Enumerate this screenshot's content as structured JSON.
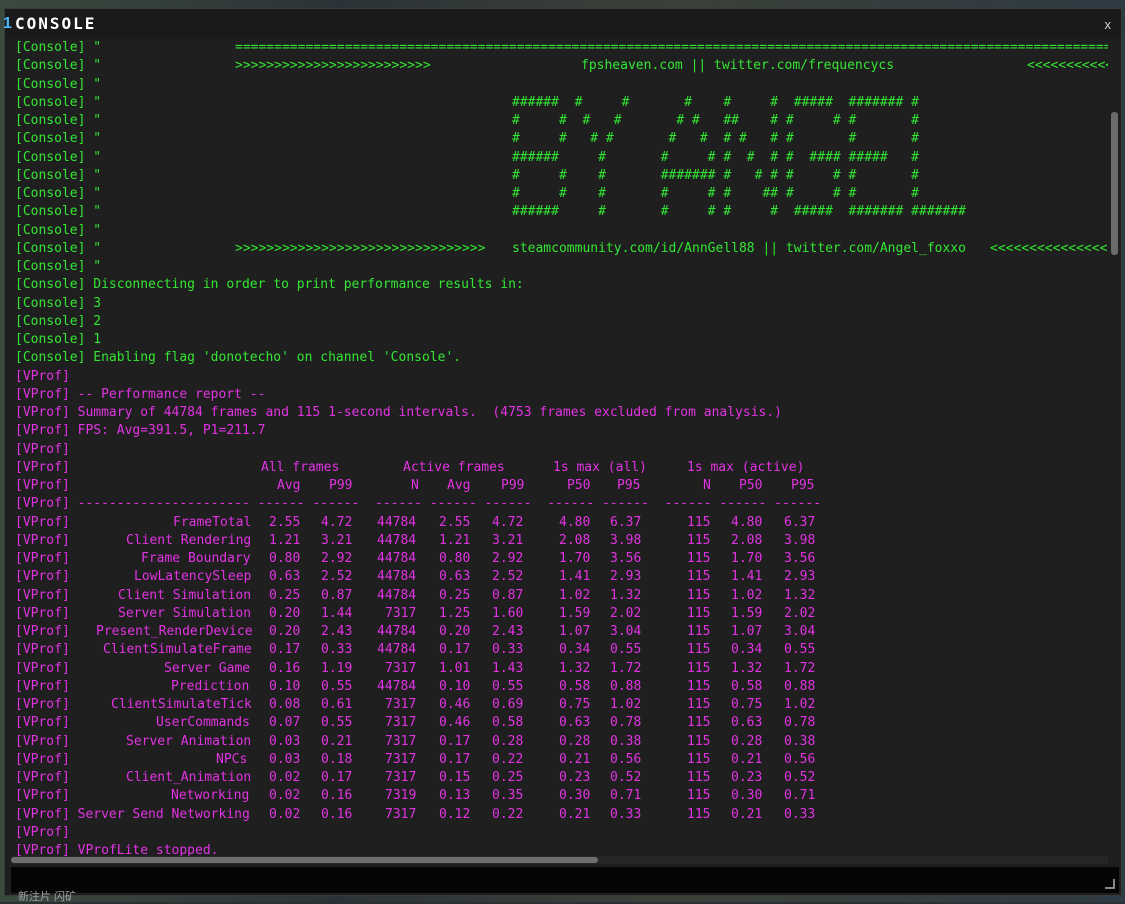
{
  "window": {
    "title_number": "1",
    "title": "CONSOLE",
    "close_label": "x"
  },
  "background_text": "新注片 闪矿",
  "lines": [
    {
      "t": "c",
      "seg": [
        [
          "[Console] \"",
          0
        ],
        [
          "==================================================================================================================================",
          220
        ]
      ]
    },
    {
      "t": "c",
      "seg": [
        [
          "[Console] \"",
          0
        ],
        [
          ">>>>>>>>>>>>>>>>>>>>>>>>>",
          220
        ],
        [
          "fpsheaven.com || twitter.com/frequencycs",
          566
        ],
        [
          "<<<<<<<<<<<<<<<",
          1012
        ]
      ]
    },
    {
      "t": "c",
      "seg": [
        [
          "[Console] \"",
          0
        ]
      ]
    },
    {
      "t": "c",
      "seg": [
        [
          "[Console] \"",
          0
        ],
        [
          "######  #     #       #    #     #  #####  ####### #",
          497
        ]
      ]
    },
    {
      "t": "c",
      "seg": [
        [
          "[Console] \"",
          0
        ],
        [
          "#     #  #   #       # #   ##    # #     # #       #",
          497
        ]
      ]
    },
    {
      "t": "c",
      "seg": [
        [
          "[Console] \"",
          0
        ],
        [
          "#     #   # #       #   #  # #   # #       #       #",
          497
        ]
      ]
    },
    {
      "t": "c",
      "seg": [
        [
          "[Console] \"",
          0
        ],
        [
          "######     #       #     # #  #  # #  #### #####   #",
          497
        ]
      ]
    },
    {
      "t": "c",
      "seg": [
        [
          "[Console] \"",
          0
        ],
        [
          "#     #    #       ####### #   # # #     # #       #",
          497
        ]
      ]
    },
    {
      "t": "c",
      "seg": [
        [
          "[Console] \"",
          0
        ],
        [
          "#     #    #       #     # #    ## #     # #       #",
          497
        ]
      ]
    },
    {
      "t": "c",
      "seg": [
        [
          "[Console] \"",
          0
        ],
        [
          "######     #       #     # #     #  #####  ####### #######",
          497
        ]
      ]
    },
    {
      "t": "c",
      "seg": [
        [
          "[Console] \"",
          0
        ]
      ]
    },
    {
      "t": "c",
      "seg": [
        [
          "[Console] \"",
          0
        ],
        [
          ">>>>>>>>>>>>>>>>>>>>>>>>>>>>>>>>",
          220
        ],
        [
          "steamcommunity.com/id/AnnGell88 || twitter.com/Angel_foxxo",
          497
        ],
        [
          "<<<<<<<<<<<<<<<",
          975
        ]
      ]
    },
    {
      "t": "c",
      "seg": [
        [
          "[Console] \"",
          0
        ]
      ]
    },
    {
      "t": "c",
      "seg": [
        [
          "[Console] Disconnecting in order to print performance results in:",
          0
        ]
      ]
    },
    {
      "t": "c",
      "seg": [
        [
          "[Console] 3",
          0
        ]
      ]
    },
    {
      "t": "c",
      "seg": [
        [
          "[Console] 2",
          0
        ]
      ]
    },
    {
      "t": "c",
      "seg": [
        [
          "[Console] 1",
          0
        ]
      ]
    },
    {
      "t": "c",
      "seg": [
        [
          "[Console] Enabling flag 'donotecho' on channel 'Console'.",
          0
        ]
      ]
    },
    {
      "t": "v",
      "seg": [
        [
          "[VProf]",
          0
        ]
      ]
    },
    {
      "t": "v",
      "seg": [
        [
          "[VProf] -- Performance report --",
          0
        ]
      ]
    },
    {
      "t": "v",
      "seg": [
        [
          "[VProf] Summary of 44784 frames and 115 1-second intervals.  (4753 frames excluded from analysis.)",
          0
        ]
      ]
    },
    {
      "t": "v",
      "seg": [
        [
          "[VProf] FPS: Avg=391.5, P1=211.7",
          0
        ]
      ]
    },
    {
      "t": "v",
      "seg": [
        [
          "[VProf]",
          0
        ]
      ]
    },
    {
      "t": "v",
      "seg": [
        [
          "[VProf]",
          0
        ],
        [
          "All frames",
          246
        ],
        [
          "Active frames",
          388
        ],
        [
          "1s max (all)",
          538
        ],
        [
          "1s max (active)",
          672
        ]
      ]
    },
    {
      "t": "v",
      "seg": [
        [
          "[VProf]",
          0
        ],
        [
          "Avg",
          262
        ],
        [
          "P99",
          314
        ],
        [
          "N",
          396
        ],
        [
          "Avg",
          432
        ],
        [
          "P99",
          486
        ],
        [
          "P50",
          552
        ],
        [
          "P95",
          602
        ],
        [
          "N",
          688
        ],
        [
          "P50",
          724
        ],
        [
          "P95",
          776
        ]
      ]
    },
    {
      "t": "v",
      "seg": [
        [
          "[VProf] ---------------------- ------ ------  ------ ------ ------  ------ ------  ------ ------ ------",
          0
        ]
      ]
    },
    {
      "t": "v",
      "seg": [
        [
          "[VProf]",
          0
        ],
        [
          "FrameTotal",
          158
        ],
        [
          "2.55",
          254
        ],
        [
          "4.72",
          306
        ],
        [
          "44784",
          362
        ],
        [
          "2.55",
          424
        ],
        [
          "4.72",
          477
        ],
        [
          "4.80",
          544
        ],
        [
          "6.37",
          595
        ],
        [
          "115",
          672
        ],
        [
          "4.80",
          716
        ],
        [
          "6.37",
          769
        ]
      ]
    },
    {
      "t": "v",
      "seg": [
        [
          "[VProf]",
          0
        ],
        [
          "Client Rendering",
          111
        ],
        [
          "1.21",
          254
        ],
        [
          "3.21",
          306
        ],
        [
          "44784",
          362
        ],
        [
          "1.21",
          424
        ],
        [
          "3.21",
          477
        ],
        [
          "2.08",
          544
        ],
        [
          "3.98",
          595
        ],
        [
          "115",
          672
        ],
        [
          "2.08",
          716
        ],
        [
          "3.98",
          769
        ]
      ]
    },
    {
      "t": "v",
      "seg": [
        [
          "[VProf]",
          0
        ],
        [
          "Frame Boundary",
          126
        ],
        [
          "0.80",
          254
        ],
        [
          "2.92",
          306
        ],
        [
          "44784",
          362
        ],
        [
          "0.80",
          424
        ],
        [
          "2.92",
          477
        ],
        [
          "1.70",
          544
        ],
        [
          "3.56",
          595
        ],
        [
          "115",
          672
        ],
        [
          "1.70",
          716
        ],
        [
          "3.56",
          769
        ]
      ]
    },
    {
      "t": "v",
      "seg": [
        [
          "[VProf]",
          0
        ],
        [
          "LowLatencySleep",
          119
        ],
        [
          "0.63",
          254
        ],
        [
          "2.52",
          306
        ],
        [
          "44784",
          362
        ],
        [
          "0.63",
          424
        ],
        [
          "2.52",
          477
        ],
        [
          "1.41",
          544
        ],
        [
          "2.93",
          595
        ],
        [
          "115",
          672
        ],
        [
          "1.41",
          716
        ],
        [
          "2.93",
          769
        ]
      ]
    },
    {
      "t": "v",
      "seg": [
        [
          "[VProf]",
          0
        ],
        [
          "Client Simulation",
          103
        ],
        [
          "0.25",
          254
        ],
        [
          "0.87",
          306
        ],
        [
          "44784",
          362
        ],
        [
          "0.25",
          424
        ],
        [
          "0.87",
          477
        ],
        [
          "1.02",
          544
        ],
        [
          "1.32",
          595
        ],
        [
          "115",
          672
        ],
        [
          "1.02",
          716
        ],
        [
          "1.32",
          769
        ]
      ]
    },
    {
      "t": "v",
      "seg": [
        [
          "[VProf]",
          0
        ],
        [
          "Server Simulation",
          103
        ],
        [
          "0.20",
          254
        ],
        [
          "1.44",
          306
        ],
        [
          "7317",
          370
        ],
        [
          "1.25",
          424
        ],
        [
          "1.60",
          477
        ],
        [
          "1.59",
          544
        ],
        [
          "2.02",
          595
        ],
        [
          "115",
          672
        ],
        [
          "1.59",
          716
        ],
        [
          "2.02",
          769
        ]
      ]
    },
    {
      "t": "v",
      "seg": [
        [
          "[VProf]",
          0
        ],
        [
          "Present_RenderDevice",
          81
        ],
        [
          "0.20",
          254
        ],
        [
          "2.43",
          306
        ],
        [
          "44784",
          362
        ],
        [
          "0.20",
          424
        ],
        [
          "2.43",
          477
        ],
        [
          "1.07",
          544
        ],
        [
          "3.04",
          595
        ],
        [
          "115",
          672
        ],
        [
          "1.07",
          716
        ],
        [
          "3.04",
          769
        ]
      ]
    },
    {
      "t": "v",
      "seg": [
        [
          "[VProf]",
          0
        ],
        [
          "ClientSimulateFrame",
          88
        ],
        [
          "0.17",
          254
        ],
        [
          "0.33",
          306
        ],
        [
          "44784",
          362
        ],
        [
          "0.17",
          424
        ],
        [
          "0.33",
          477
        ],
        [
          "0.34",
          544
        ],
        [
          "0.55",
          595
        ],
        [
          "115",
          672
        ],
        [
          "0.34",
          716
        ],
        [
          "0.55",
          769
        ]
      ]
    },
    {
      "t": "v",
      "seg": [
        [
          "[VProf]",
          0
        ],
        [
          "Server Game",
          149
        ],
        [
          "0.16",
          254
        ],
        [
          "1.19",
          306
        ],
        [
          "7317",
          370
        ],
        [
          "1.01",
          424
        ],
        [
          "1.43",
          477
        ],
        [
          "1.32",
          544
        ],
        [
          "1.72",
          595
        ],
        [
          "115",
          672
        ],
        [
          "1.32",
          716
        ],
        [
          "1.72",
          769
        ]
      ]
    },
    {
      "t": "v",
      "seg": [
        [
          "[VProf]",
          0
        ],
        [
          "Prediction",
          156
        ],
        [
          "0.10",
          254
        ],
        [
          "0.55",
          306
        ],
        [
          "44784",
          362
        ],
        [
          "0.10",
          424
        ],
        [
          "0.55",
          477
        ],
        [
          "0.58",
          544
        ],
        [
          "0.88",
          595
        ],
        [
          "115",
          672
        ],
        [
          "0.58",
          716
        ],
        [
          "0.88",
          769
        ]
      ]
    },
    {
      "t": "v",
      "seg": [
        [
          "[VProf]",
          0
        ],
        [
          "ClientSimulateTick",
          96
        ],
        [
          "0.08",
          254
        ],
        [
          "0.61",
          306
        ],
        [
          "7317",
          370
        ],
        [
          "0.46",
          424
        ],
        [
          "0.69",
          477
        ],
        [
          "0.75",
          544
        ],
        [
          "1.02",
          595
        ],
        [
          "115",
          672
        ],
        [
          "0.75",
          716
        ],
        [
          "1.02",
          769
        ]
      ]
    },
    {
      "t": "v",
      "seg": [
        [
          "[VProf]",
          0
        ],
        [
          "UserCommands",
          141
        ],
        [
          "0.07",
          254
        ],
        [
          "0.55",
          306
        ],
        [
          "7317",
          370
        ],
        [
          "0.46",
          424
        ],
        [
          "0.58",
          477
        ],
        [
          "0.63",
          544
        ],
        [
          "0.78",
          595
        ],
        [
          "115",
          672
        ],
        [
          "0.63",
          716
        ],
        [
          "0.78",
          769
        ]
      ]
    },
    {
      "t": "v",
      "seg": [
        [
          "[VProf]",
          0
        ],
        [
          "Server Animation",
          111
        ],
        [
          "0.03",
          254
        ],
        [
          "0.21",
          306
        ],
        [
          "7317",
          370
        ],
        [
          "0.17",
          424
        ],
        [
          "0.28",
          477
        ],
        [
          "0.28",
          544
        ],
        [
          "0.38",
          595
        ],
        [
          "115",
          672
        ],
        [
          "0.28",
          716
        ],
        [
          "0.38",
          769
        ]
      ]
    },
    {
      "t": "v",
      "seg": [
        [
          "[VProf]",
          0
        ],
        [
          "NPCs",
          201
        ],
        [
          "0.03",
          254
        ],
        [
          "0.18",
          306
        ],
        [
          "7317",
          370
        ],
        [
          "0.17",
          424
        ],
        [
          "0.22",
          477
        ],
        [
          "0.21",
          544
        ],
        [
          "0.56",
          595
        ],
        [
          "115",
          672
        ],
        [
          "0.21",
          716
        ],
        [
          "0.56",
          769
        ]
      ]
    },
    {
      "t": "v",
      "seg": [
        [
          "[VProf]",
          0
        ],
        [
          "Client_Animation",
          111
        ],
        [
          "0.02",
          254
        ],
        [
          "0.17",
          306
        ],
        [
          "7317",
          370
        ],
        [
          "0.15",
          424
        ],
        [
          "0.25",
          477
        ],
        [
          "0.23",
          544
        ],
        [
          "0.52",
          595
        ],
        [
          "115",
          672
        ],
        [
          "0.23",
          716
        ],
        [
          "0.52",
          769
        ]
      ]
    },
    {
      "t": "v",
      "seg": [
        [
          "[VProf]",
          0
        ],
        [
          "Networking",
          156
        ],
        [
          "0.02",
          254
        ],
        [
          "0.16",
          306
        ],
        [
          "7319",
          370
        ],
        [
          "0.13",
          424
        ],
        [
          "0.35",
          477
        ],
        [
          "0.30",
          544
        ],
        [
          "0.71",
          595
        ],
        [
          "115",
          672
        ],
        [
          "0.30",
          716
        ],
        [
          "0.71",
          769
        ]
      ]
    },
    {
      "t": "v",
      "seg": [
        [
          "[VProf] Server Send Networking",
          0
        ],
        [
          "0.02",
          254
        ],
        [
          "0.16",
          306
        ],
        [
          "7317",
          370
        ],
        [
          "0.12",
          424
        ],
        [
          "0.22",
          477
        ],
        [
          "0.21",
          544
        ],
        [
          "0.33",
          595
        ],
        [
          "115",
          672
        ],
        [
          "0.21",
          716
        ],
        [
          "0.33",
          769
        ]
      ]
    },
    {
      "t": "v",
      "seg": [
        [
          "[VProf]",
          0
        ]
      ]
    },
    {
      "t": "v",
      "seg": [
        [
          "[VProf] VProfLite stopped.",
          0
        ]
      ]
    }
  ],
  "input": {
    "value": ""
  }
}
